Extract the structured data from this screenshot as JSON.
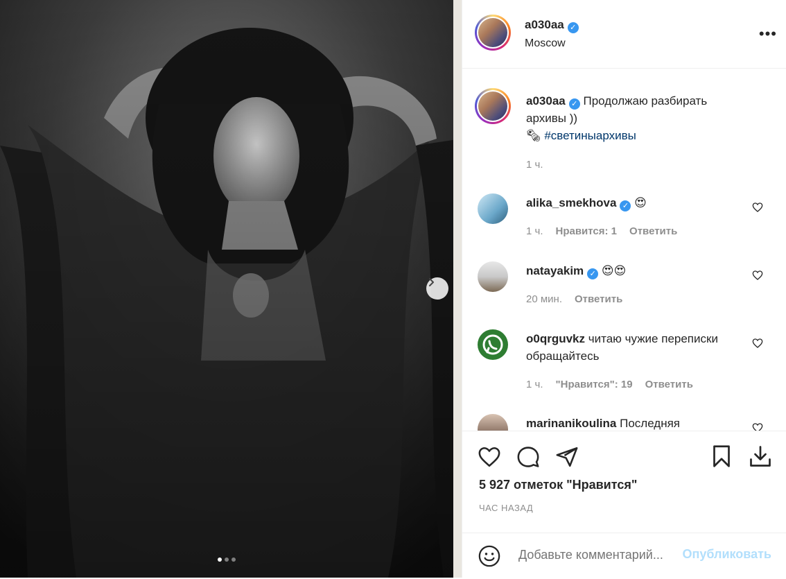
{
  "post": {
    "author": "a030aa",
    "location": "Moscow",
    "caption_text": "Продолжаю разбирать архивы ))",
    "caption_emoji": "🗞",
    "hashtag": "#светиныархивы",
    "caption_time": "1 ч.",
    "likes_text": "5 927 отметок \"Нравится\"",
    "time_ago": "ЧАС НАЗАД",
    "carousel": {
      "total": 3,
      "active": 1
    }
  },
  "comments": [
    {
      "user": "alika_smekhova",
      "verified": true,
      "text": "😍",
      "time": "1 ч.",
      "likes": "Нравится: 1",
      "reply": "Ответить"
    },
    {
      "user": "natayakim",
      "verified": true,
      "text": "😍😍",
      "time": "20 мин.",
      "likes": "",
      "reply": "Ответить"
    },
    {
      "user": "o0qrguvkz",
      "verified": false,
      "text": "читаю чужие переписки обращайтесь",
      "time": "1 ч.",
      "likes": "\"Нравится\": 19",
      "reply": "Ответить"
    },
    {
      "user": "marinanikoulina",
      "verified": false,
      "text": "Последняя"
    }
  ],
  "add_comment": {
    "placeholder": "Добавьте комментарий...",
    "publish": "Опубликовать"
  },
  "colors": {
    "accent": "#3897f0",
    "hashtag": "#00376b",
    "publish_disabled": "#b2dffc",
    "muted": "#8e8e8e"
  }
}
